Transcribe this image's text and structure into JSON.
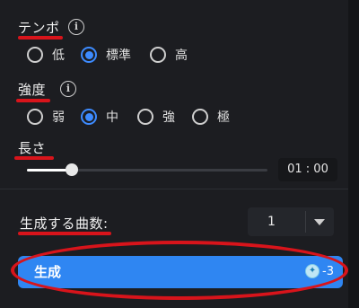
{
  "tempo": {
    "label": "テンポ",
    "options": [
      "低",
      "標準",
      "高"
    ],
    "selected": "標準"
  },
  "strength": {
    "label": "強度",
    "options": [
      "弱",
      "中",
      "強",
      "極"
    ],
    "selected": "中"
  },
  "length": {
    "label": "長さ",
    "value_text": "01 : 00"
  },
  "count": {
    "label": "生成する曲数:",
    "value": "1"
  },
  "generate": {
    "label": "生成",
    "credit_text": "-3"
  },
  "icons": {
    "info": "info-icon",
    "caret": "chevron-down-icon",
    "credit": "credit-gem-icon"
  },
  "colors": {
    "accent": "#2f86f2",
    "annotation": "#d8141b",
    "background": "#1c1d21"
  }
}
